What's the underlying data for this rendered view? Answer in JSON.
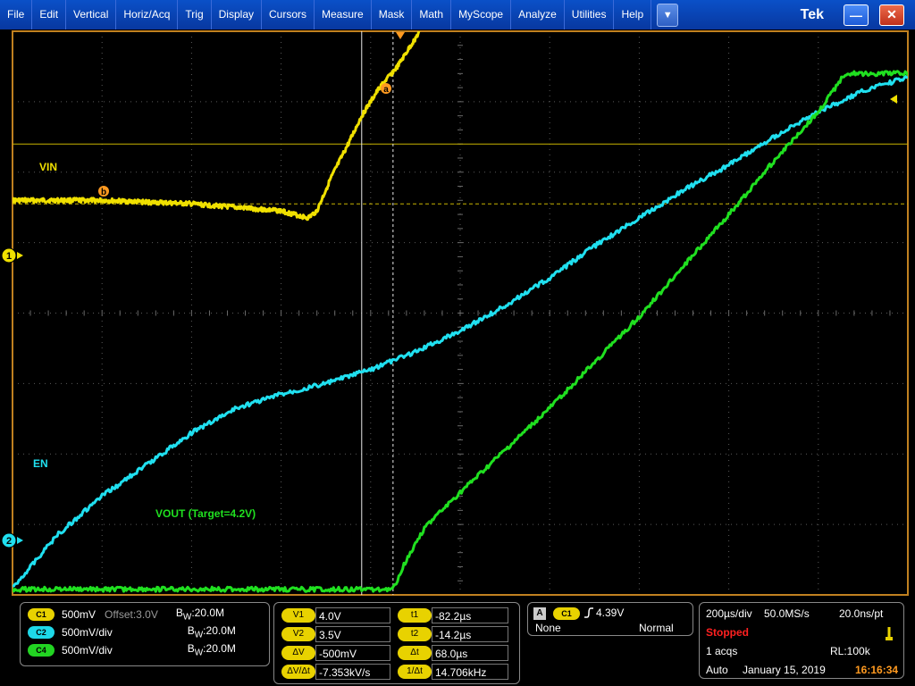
{
  "menu": {
    "items": [
      "File",
      "Edit",
      "Vertical",
      "Horiz/Acq",
      "Trig",
      "Display",
      "Cursors",
      "Measure",
      "Mask",
      "Math",
      "MyScope",
      "Analyze",
      "Utilities",
      "Help"
    ],
    "dropdown_glyph": "▼",
    "brand": "Tek",
    "minimize_glyph": "—",
    "close_glyph": "✕"
  },
  "screen": {
    "label_vin": "VIN",
    "label_en": "EN",
    "label_vout": "VOUT (Target=4.2V)",
    "marker_1": "1",
    "marker_2": "2",
    "cursor_a": "a",
    "cursor_b": "b"
  },
  "channels": [
    {
      "badge": "C1",
      "scale": "500mV",
      "offset": "Offset:3.0V",
      "bw": "20.0M"
    },
    {
      "badge": "C2",
      "scale": "500mV/div",
      "bw": "20.0M"
    },
    {
      "badge": "C4",
      "scale": "500mV/div",
      "bw": "20.0M"
    }
  ],
  "bw_prefix": "B",
  "bw_sub": "W",
  "cursors": {
    "v1_label": "V1",
    "v1": "4.0V",
    "v2_label": "V2",
    "v2": "3.5V",
    "dv_label": "ΔV",
    "dv": "-500mV",
    "dvdt_label": "ΔV/Δt",
    "dvdt": "-7.353kV/s",
    "t1_label": "t1",
    "t1": "-82.2µs",
    "t2_label": "t2",
    "t2": "-14.2µs",
    "dt_label": "Δt",
    "dt": "68.0µs",
    "inv_dt_label": "1/Δt",
    "inv_dt": "14.706kHz"
  },
  "trigger": {
    "a_badge": "A",
    "source": "C1",
    "level": "4.39V",
    "coupling": "None",
    "mode": "Normal"
  },
  "acquisition": {
    "timebase": "200µs/div",
    "sample_rate": "50.0MS/s",
    "resolution": "20.0ns/pt",
    "state": "Stopped",
    "acqs": "1 acqs",
    "record_length": "RL:100k",
    "mode": "Auto",
    "date": "January 15, 2019",
    "time": "16:16:34"
  },
  "colors": {
    "ch1_yellow": "#f0e000",
    "ch2_cyan": "#20e0f0",
    "ch4_green": "#20e020",
    "graticule_border": "#c08020",
    "cursor_orange": "#ff9a20"
  },
  "chart_data": {
    "type": "line",
    "x_unit": "div",
    "y_unit": "div",
    "xlim": [
      0,
      10
    ],
    "ylim": [
      0,
      8
    ],
    "series": [
      {
        "name": "VIN",
        "color": "#f0e000",
        "x": [
          0,
          1.0,
          2.0,
          3.0,
          3.3,
          3.4,
          3.55,
          3.75,
          3.9,
          4.1,
          4.3,
          4.5,
          4.7,
          4.9
        ],
        "y": [
          5.6,
          5.6,
          5.55,
          5.45,
          5.35,
          5.45,
          5.9,
          6.4,
          6.8,
          7.2,
          7.5,
          7.9,
          8.3,
          8.7
        ]
      },
      {
        "name": "EN",
        "color": "#20e0f0",
        "x": [
          0,
          0.5,
          1.0,
          1.5,
          2.0,
          2.5,
          3.0,
          3.5,
          4.0,
          4.5,
          5.0,
          5.5,
          6.0,
          6.5,
          7.0,
          7.5,
          8.0,
          8.5,
          9.0,
          9.5,
          10.0
        ],
        "y": [
          0.1,
          0.85,
          1.4,
          1.85,
          2.3,
          2.65,
          2.85,
          3.0,
          3.2,
          3.45,
          3.75,
          4.1,
          4.5,
          4.95,
          5.35,
          5.75,
          6.1,
          6.5,
          6.85,
          7.15,
          7.35
        ]
      },
      {
        "name": "VOUT (Target=4.2V)",
        "color": "#20e020",
        "x": [
          0,
          2.0,
          4.0,
          4.25,
          4.4,
          4.6,
          5.0,
          6.0,
          7.0,
          8.0,
          8.6,
          9.0,
          9.3,
          10.0
        ],
        "y": [
          0.08,
          0.08,
          0.08,
          0.08,
          0.5,
          0.95,
          1.45,
          2.65,
          3.95,
          5.4,
          6.3,
          6.85,
          7.4,
          7.4
        ]
      }
    ],
    "cursors": {
      "h1": 6.4,
      "h2": 5.55,
      "v1": 3.9,
      "v2": 4.25
    },
    "grid": true,
    "labels": [
      "VIN",
      "EN",
      "VOUT (Target=4.2V)"
    ]
  }
}
